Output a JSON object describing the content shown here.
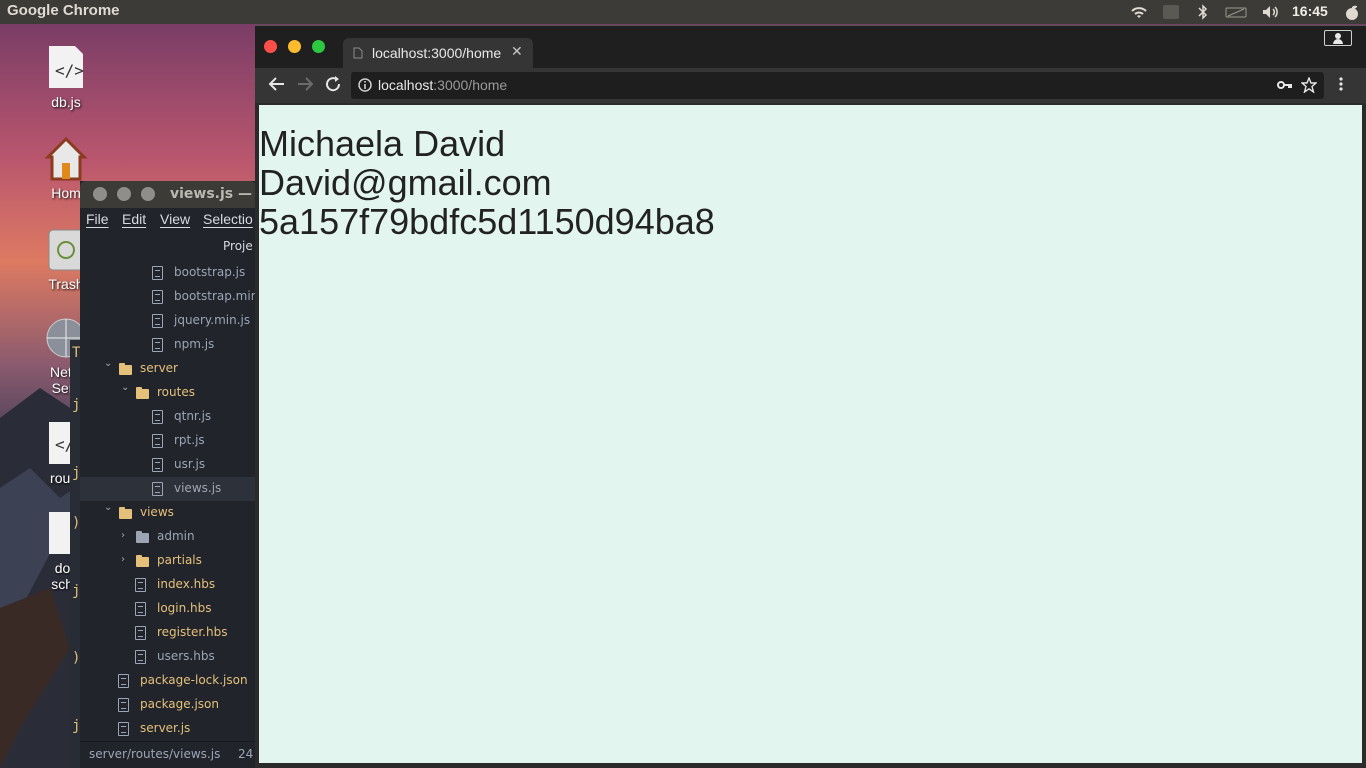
{
  "system": {
    "app_name": "Google Chrome",
    "clock": "16:45"
  },
  "desktop_icons": [
    {
      "label": "db.js",
      "icon": "code-file-icon"
    },
    {
      "label": "Hom",
      "icon": "home-folder-icon"
    },
    {
      "label": "Trash",
      "icon": "trash-icon"
    },
    {
      "label": "Netw",
      "label2": "Serv",
      "icon": "network-icon"
    },
    {
      "label": "route",
      "icon": "code-file-icon"
    },
    {
      "label": "doc",
      "label2": "sche",
      "icon": "document-icon"
    }
  ],
  "editor": {
    "title": "views.js —",
    "menu": [
      "File",
      "Edit",
      "View",
      "Selectio"
    ],
    "panel_header": "Proje",
    "tree": [
      {
        "label": "bootstrap.js",
        "kind": "file",
        "depth": 3
      },
      {
        "label": "bootstrap.mir",
        "kind": "file",
        "depth": 3
      },
      {
        "label": "jquery.min.js",
        "kind": "file",
        "depth": 3
      },
      {
        "label": "npm.js",
        "kind": "file",
        "depth": 3
      },
      {
        "label": "server",
        "kind": "folder-open",
        "depth": 1
      },
      {
        "label": "routes",
        "kind": "folder-open",
        "depth": 2
      },
      {
        "label": "qtnr.js",
        "kind": "file",
        "depth": 3
      },
      {
        "label": "rpt.js",
        "kind": "file",
        "depth": 3
      },
      {
        "label": "usr.js",
        "kind": "file",
        "depth": 3
      },
      {
        "label": "views.js",
        "kind": "file",
        "depth": 3,
        "selected": true
      },
      {
        "label": "views",
        "kind": "folder-open",
        "depth": 1
      },
      {
        "label": "admin",
        "kind": "folder-closed-grey",
        "depth": 2
      },
      {
        "label": "partials",
        "kind": "folder-closed",
        "depth": 2
      },
      {
        "label": "index.hbs",
        "kind": "file",
        "depth": 2
      },
      {
        "label": "login.hbs",
        "kind": "file",
        "depth": 2
      },
      {
        "label": "register.hbs",
        "kind": "file",
        "depth": 2
      },
      {
        "label": "users.hbs",
        "kind": "file-grey",
        "depth": 2
      },
      {
        "label": "package-lock.json",
        "kind": "file",
        "depth": 1
      },
      {
        "label": "package.json",
        "kind": "file",
        "depth": 1
      },
      {
        "label": "server.js",
        "kind": "file",
        "depth": 1
      }
    ],
    "status_path": "server/routes/views.js",
    "status_line": "24"
  },
  "gutter_chars": [
    "T",
    "j",
    "j",
    ")",
    "j",
    ")",
    "j"
  ],
  "chrome": {
    "tab_title": "localhost:3000/home",
    "url_host": "localhost",
    "url_path": ":3000/home",
    "page_lines": [
      "Michaela David",
      "David@gmail.com",
      "5a157f79bdfc5d1150d94ba8"
    ]
  },
  "colors": {
    "page_background": "#e2f5ef",
    "tree_text": "#e5c07b",
    "tree_muted": "#9da5b4",
    "folder_icon": "#e5c07b"
  }
}
